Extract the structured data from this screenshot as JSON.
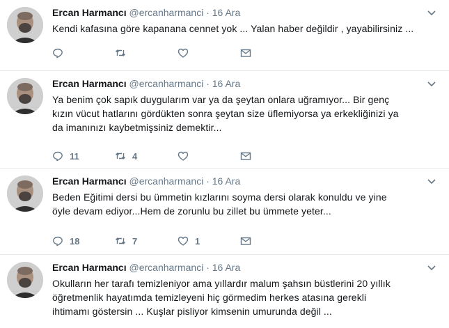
{
  "colors": {
    "icon": "#657786",
    "border": "#e6ecf0",
    "name": "#14171a"
  },
  "tweets": [
    {
      "name": "Ercan Harmancı",
      "handle": "@ercanharmanci",
      "dot": "·",
      "date": "16 Ara",
      "lines": [
        "Kendi kafasına göre kapanana cennet yok ... Yalan haber değildir , yayabilirsiniz ..."
      ],
      "reply_count": "",
      "retweet_count": "",
      "like_count": ""
    },
    {
      "name": "Ercan Harmancı",
      "handle": "@ercanharmanci",
      "dot": "·",
      "date": "16 Ara",
      "lines": [
        "Ya benim çok sapık duygularım var ya da şeytan  onlara uğramıyor... Bir  genç",
        "kızın vücut hatlarını gördükten sonra şeytan size üflemiyorsa  ya erkekliğinizi ya",
        "da imanınızı kaybetmişsiniz demektir..."
      ],
      "reply_count": "11",
      "retweet_count": "4",
      "like_count": ""
    },
    {
      "name": "Ercan Harmancı",
      "handle": "@ercanharmanci",
      "dot": "·",
      "date": "16 Ara",
      "lines": [
        "Beden Eğitimi dersi bu ümmetin kızlarını soyma dersi olarak konuldu ve  yine",
        "öyle devam ediyor...Hem de  zorunlu bu zillet bu ümmete  yeter..."
      ],
      "reply_count": "18",
      "retweet_count": "7",
      "like_count": "1"
    },
    {
      "name": "Ercan Harmancı",
      "handle": "@ercanharmanci",
      "dot": "·",
      "date": "16 Ara",
      "lines": [
        "Okulların her tarafı temizleniyor ama  yıllardır  malum şahsın büstlerini  20 yıllık",
        "öğretmenlik hayatımda temizleyeni hiç görmedim  herkes atasına  gerekli",
        "ihtimamı göstersin ... Kuşlar pisliyor  kimsenin umurunda değil ..."
      ],
      "reply_count": "",
      "retweet_count": "",
      "like_count": ""
    }
  ]
}
